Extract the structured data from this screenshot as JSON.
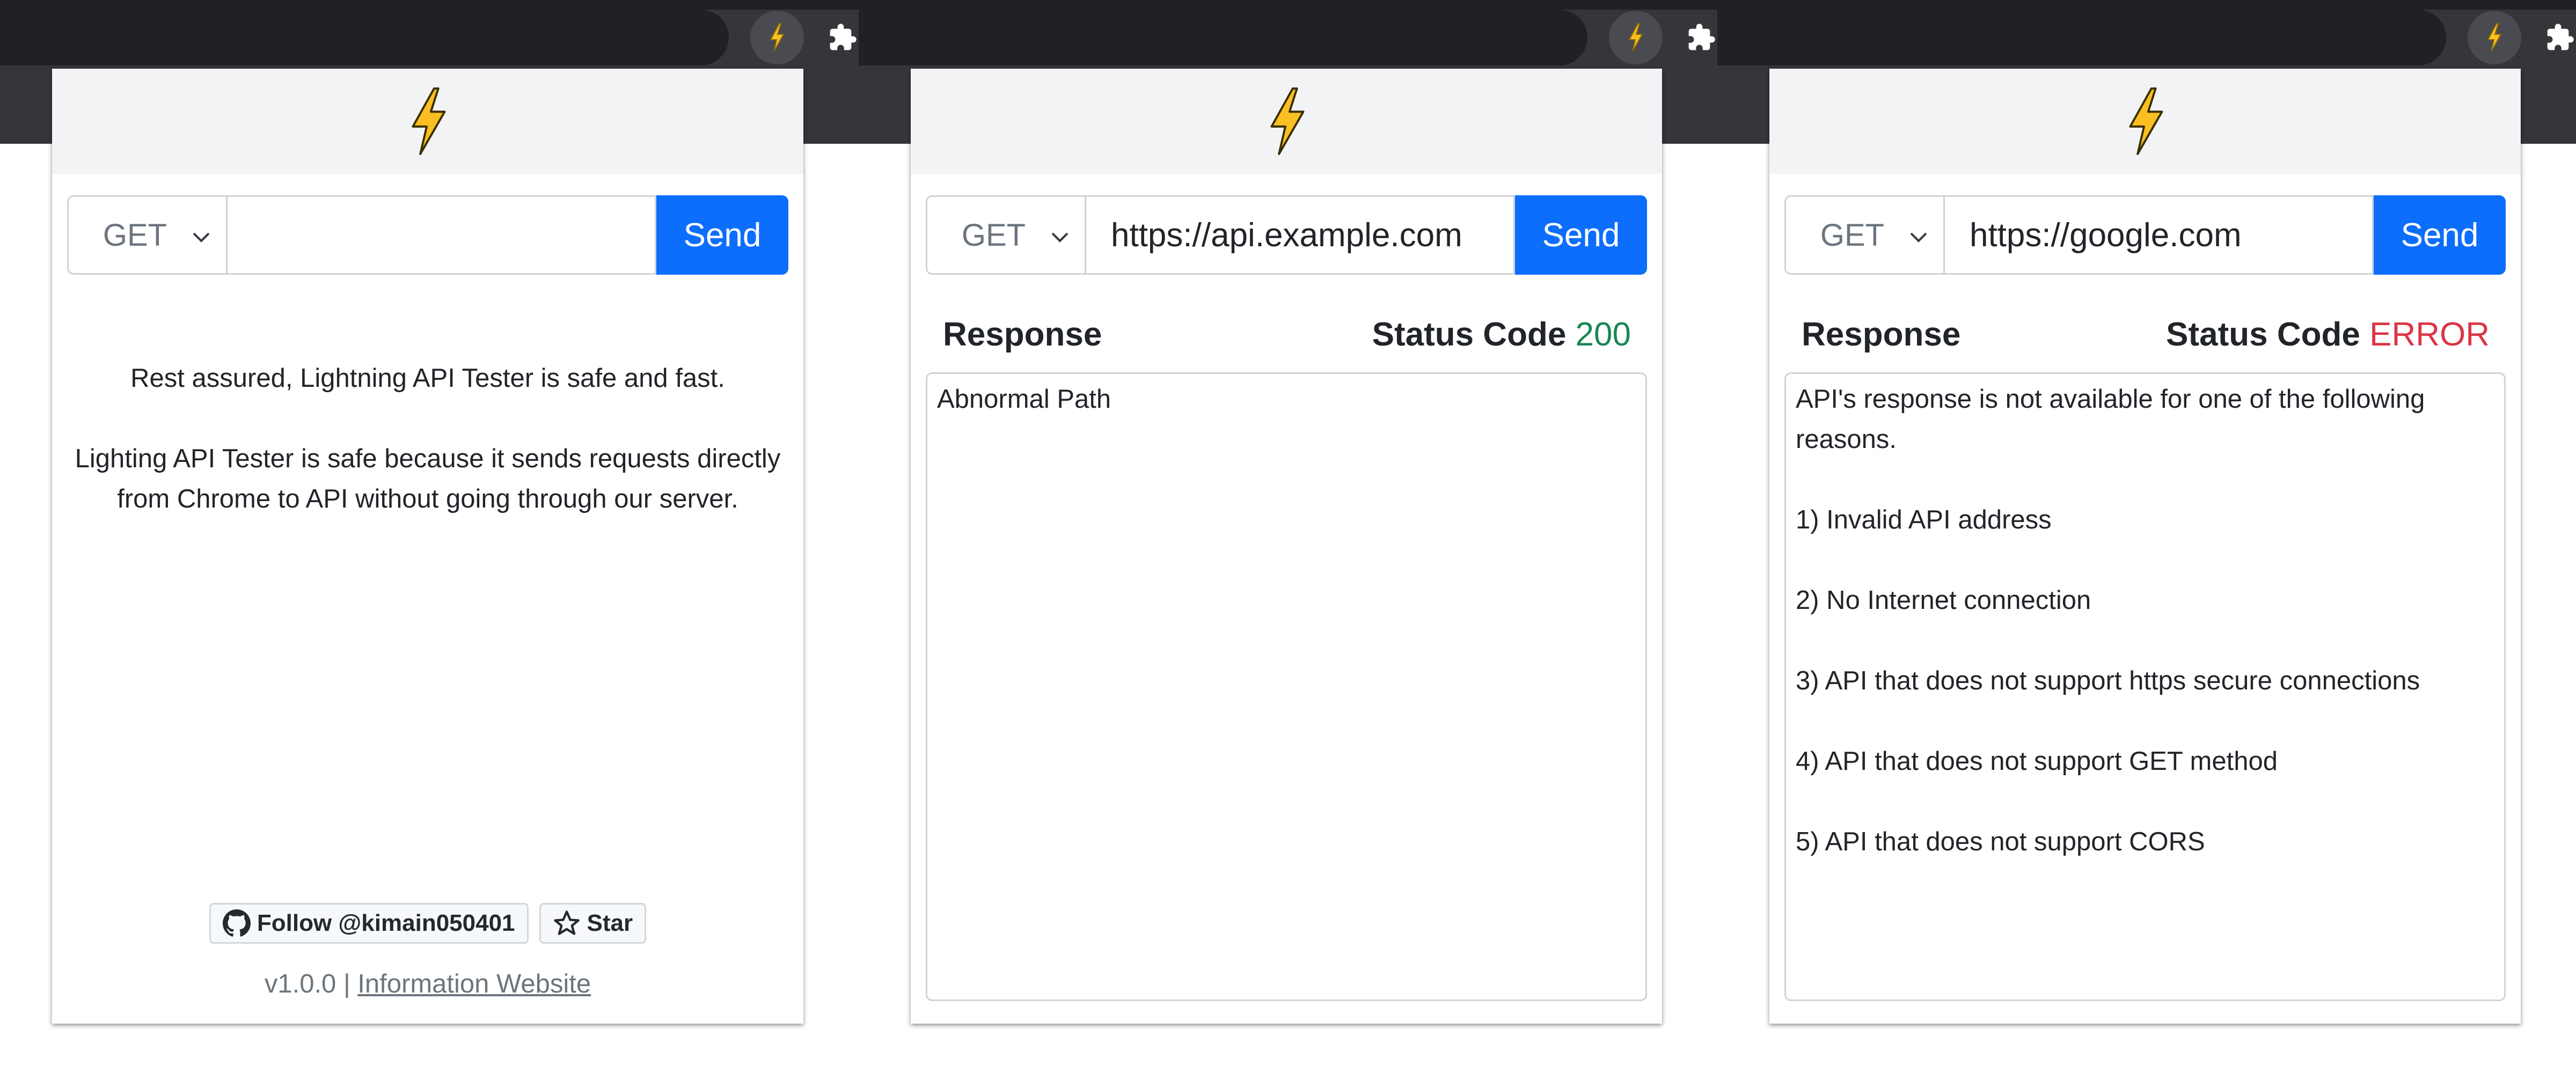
{
  "ui": {
    "accent": "#0d6efd",
    "status_ok_color": "#198754",
    "status_error_color": "#dc3545",
    "logo_icon": "lightning-bolt-icon"
  },
  "panels": [
    {
      "method": "GET",
      "url": "",
      "send_label": "Send",
      "intro": [
        "Rest assured, Lightning API Tester is safe and fast.",
        "Lighting API Tester is safe because it sends requests directly from Chrome to API without going through our server."
      ],
      "github": {
        "follow_label": "Follow @kimain050401",
        "star_label": "Star"
      },
      "footer": {
        "version": "v1.0.0",
        "separator": "|",
        "link_label": "Information Website"
      }
    },
    {
      "method": "GET",
      "url": "https://api.example.com",
      "send_label": "Send",
      "response_label": "Response",
      "status_label": "Status Code",
      "status_value": "200",
      "response_lines": [
        "Abnormal Path"
      ]
    },
    {
      "method": "GET",
      "url": "https://google.com",
      "send_label": "Send",
      "response_label": "Response",
      "status_label": "Status Code",
      "status_value": "ERROR",
      "response_lines": [
        "API's response is not available for one of the following",
        "reasons.",
        "",
        "1) Invalid API address",
        "",
        "2) No Internet connection",
        "",
        "3) API that does not support https secure connections",
        "",
        "4) API that does not support GET method",
        "",
        "5) API that does not support CORS"
      ]
    }
  ]
}
